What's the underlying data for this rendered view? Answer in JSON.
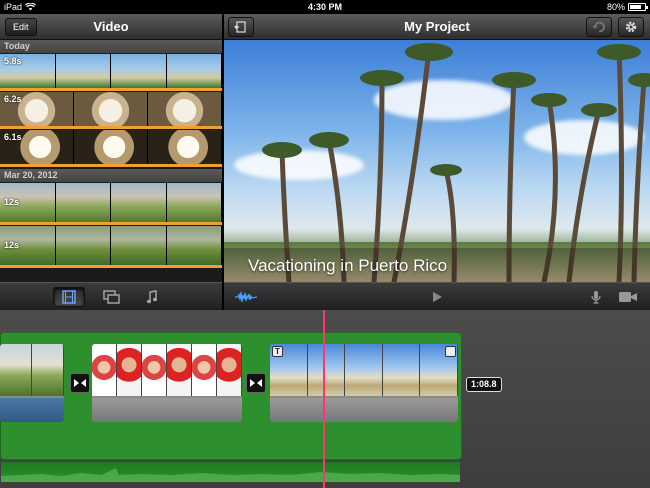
{
  "status": {
    "device": "iPad",
    "time": "4:30 PM",
    "battery": "80%",
    "battery_level": 0.8
  },
  "browser": {
    "title": "Video",
    "edit_label": "Edit",
    "sections": [
      {
        "label": "Today",
        "clips": [
          {
            "duration": "5.8s",
            "kind": "beach"
          },
          {
            "duration": "6.2s",
            "kind": "dog"
          },
          {
            "duration": "6.1s",
            "kind": "dog2"
          }
        ]
      },
      {
        "label": "Mar 20, 2012",
        "clips": [
          {
            "duration": "12s",
            "kind": "kid"
          },
          {
            "duration": "12s",
            "kind": "kid2"
          }
        ]
      }
    ]
  },
  "viewer": {
    "title": "My Project",
    "caption": "Vacationing in Puerto Rico"
  },
  "timeline": {
    "selected_duration": "1:08.8",
    "clip_title_badge": "T"
  },
  "colors": {
    "accent_orange": "#f0a030",
    "timeline_green": "#2e8f2e",
    "playhead": "#ff3570"
  }
}
